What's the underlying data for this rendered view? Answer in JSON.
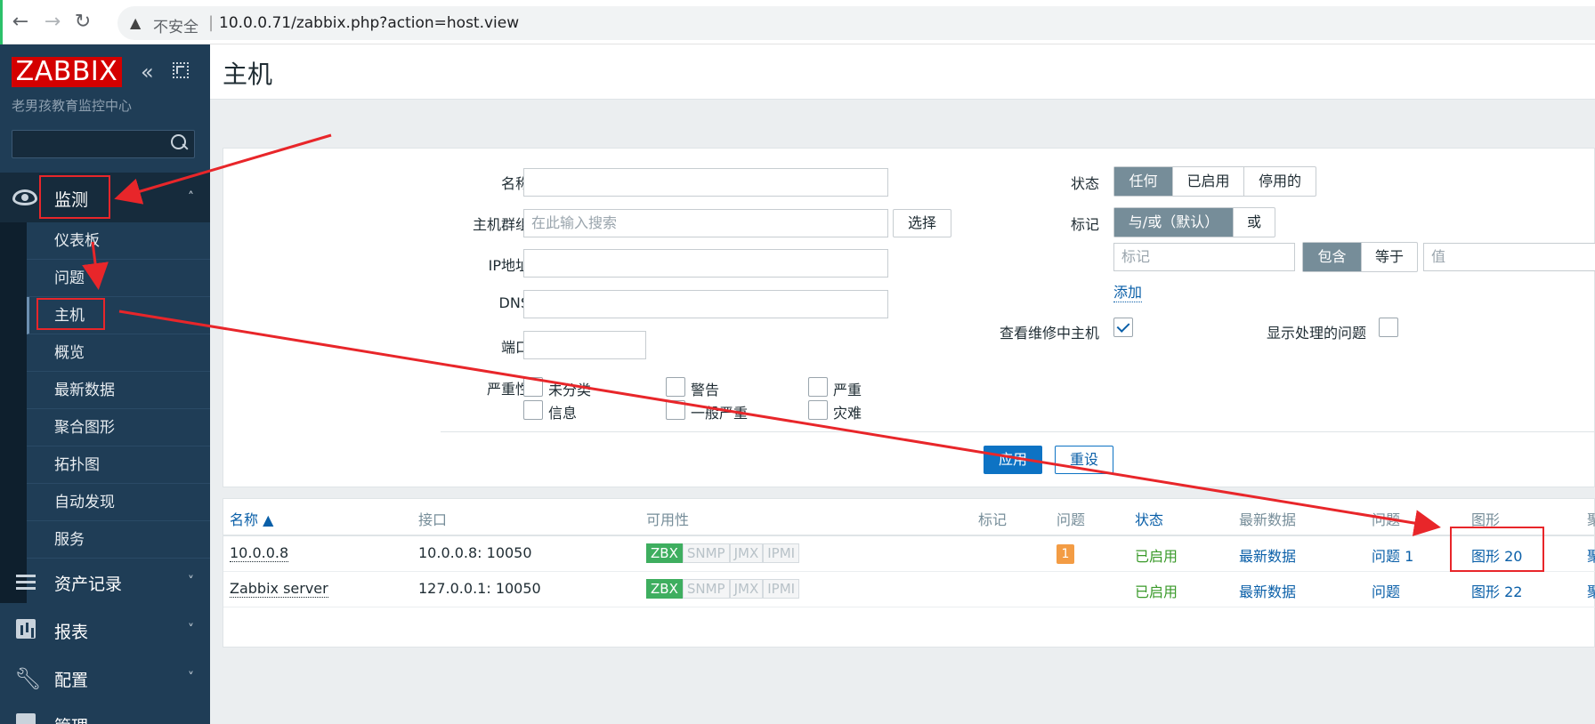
{
  "browser": {
    "insecure_label": "不安全",
    "separator": "|",
    "url": "10.0.0.71/zabbix.php?action=host.view"
  },
  "sidebar": {
    "logo": "ZABBIX",
    "subtitle": "老男孩教育监控中心",
    "monitor_label": "监测",
    "monitor_items": [
      "仪表板",
      "问题",
      "主机",
      "概览",
      "最新数据",
      "聚合图形",
      "拓扑图",
      "自动发现",
      "服务"
    ],
    "active_item": "主机",
    "sections": [
      "资产记录",
      "报表",
      "配置",
      "管理"
    ]
  },
  "page": {
    "title": "主机"
  },
  "filter": {
    "name_label": "名称",
    "group_label": "主机群组",
    "group_placeholder": "在此输入搜索",
    "select_button": "选择",
    "ip_label": "IP地址",
    "dns_label": "DNS",
    "port_label": "端口",
    "severity_label": "严重性",
    "severities": [
      "未分类",
      "警告",
      "严重",
      "信息",
      "一般严重",
      "灾难"
    ],
    "status_label": "状态",
    "status_options": [
      "任何",
      "已启用",
      "停用的"
    ],
    "status_selected": "任何",
    "tags_label": "标记",
    "tag_ops": [
      "与/或（默认）",
      "或"
    ],
    "tag_placeholder": "标记",
    "tag_match": [
      "包含",
      "等于"
    ],
    "value_placeholder": "值",
    "add_link": "添加",
    "maintenance_label": "查看维修中主机",
    "maintenance_checked": true,
    "suppressed_label": "显示处理的问题",
    "suppressed_checked": false,
    "apply_button": "应用",
    "reset_button": "重设"
  },
  "table": {
    "columns": [
      "名称 ▲",
      "接口",
      "可用性",
      "标记",
      "问题",
      "状态",
      "最新数据",
      "问题",
      "图形",
      "聚"
    ],
    "rows": [
      {
        "name": "10.0.0.8",
        "interface": "10.0.0.8: 10050",
        "availability": [
          "ZBX",
          "SNMP",
          "JMX",
          "IPMI"
        ],
        "problems_badge": "1",
        "status": "已启用",
        "latest": "最新数据",
        "problems_link": "问题 1",
        "graphs": "图形 20",
        "extra": "聚"
      },
      {
        "name": "Zabbix server",
        "interface": "127.0.0.1: 10050",
        "availability": [
          "ZBX",
          "SNMP",
          "JMX",
          "IPMI"
        ],
        "problems_badge": "",
        "status": "已启用",
        "latest": "最新数据",
        "problems_link": "问题",
        "graphs": "图形 22",
        "extra": "聚"
      }
    ]
  },
  "colors": {
    "sidebar_bg": "#1f3d56",
    "logo_red": "#d40000",
    "accent_blue": "#0d73c4",
    "annotation_red": "#e8262a",
    "status_green": "#3a9a2a"
  }
}
